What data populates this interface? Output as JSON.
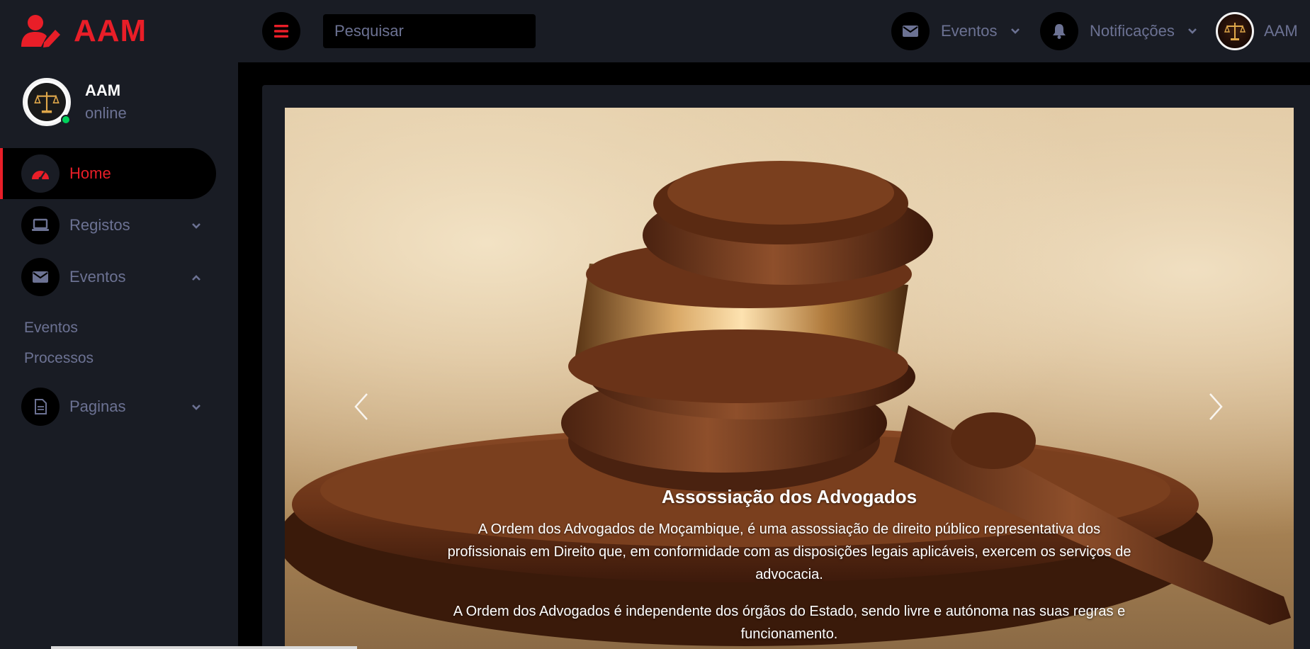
{
  "brand": {
    "name": "AAM",
    "logo_icon": "user-edit-icon",
    "color": "#e91e28"
  },
  "topbar": {
    "menu_icon": "hamburger-icon",
    "search": {
      "placeholder": "Pesquisar",
      "value": ""
    },
    "events": {
      "label": "Eventos",
      "icon": "envelope-icon"
    },
    "notifications": {
      "label": "Notificações",
      "icon": "bell-icon"
    },
    "user": {
      "label": "AAM",
      "icon": "scales-of-justice-icon"
    }
  },
  "sidebar": {
    "profile": {
      "name": "AAM",
      "status": "online",
      "status_color": "#00d25b"
    },
    "items": [
      {
        "label": "Home",
        "icon": "speedometer-icon",
        "active": true
      },
      {
        "label": "Registos",
        "icon": "laptop-icon",
        "expanded": false
      },
      {
        "label": "Eventos",
        "icon": "envelope-icon",
        "expanded": true,
        "subitems": [
          {
            "label": "Eventos"
          },
          {
            "label": "Processos"
          }
        ]
      },
      {
        "label": "Paginas",
        "icon": "file-document-icon",
        "expanded": false
      }
    ]
  },
  "carousel": {
    "image": "judge-gavel-photo",
    "caption": {
      "title": "Assossiação dos Advogados",
      "paragraph1": "A Ordem dos Advogados de Moçambique, é uma assossiação de direito público representativa dos profissionais em Direito que, em conformidade com as disposições legais aplicáveis, exercem os serviços de advocacia.",
      "paragraph2": "A Ordem dos Advogados é independente dos órgãos do Estado, sendo livre e autónoma nas suas regras e funcionamento."
    }
  },
  "colors": {
    "background": "#191c24",
    "content_bg": "#000000",
    "accent": "#e91e28",
    "muted_text": "#6c7293"
  }
}
